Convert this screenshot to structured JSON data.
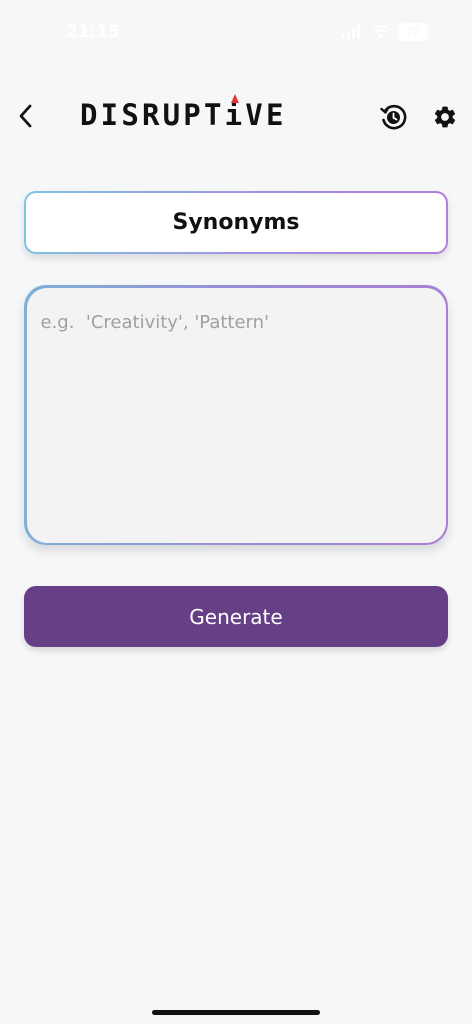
{
  "status_bar": {
    "time": "21:15",
    "battery": "70"
  },
  "header": {
    "back_icon": "chevron-left-icon",
    "logo_text_left": "DISRUPT",
    "logo_text_mark": "i",
    "logo_text_right": "VE",
    "logo_accent_color": "#e4343a",
    "history_icon": "history-clock-icon",
    "settings_icon": "gear-icon"
  },
  "mode": {
    "label": "Synonyms"
  },
  "input": {
    "value": "",
    "placeholder": "e.g.  'Creativity', 'Pattern'"
  },
  "actions": {
    "generate_label": "Generate",
    "generate_color": "#673f86"
  }
}
